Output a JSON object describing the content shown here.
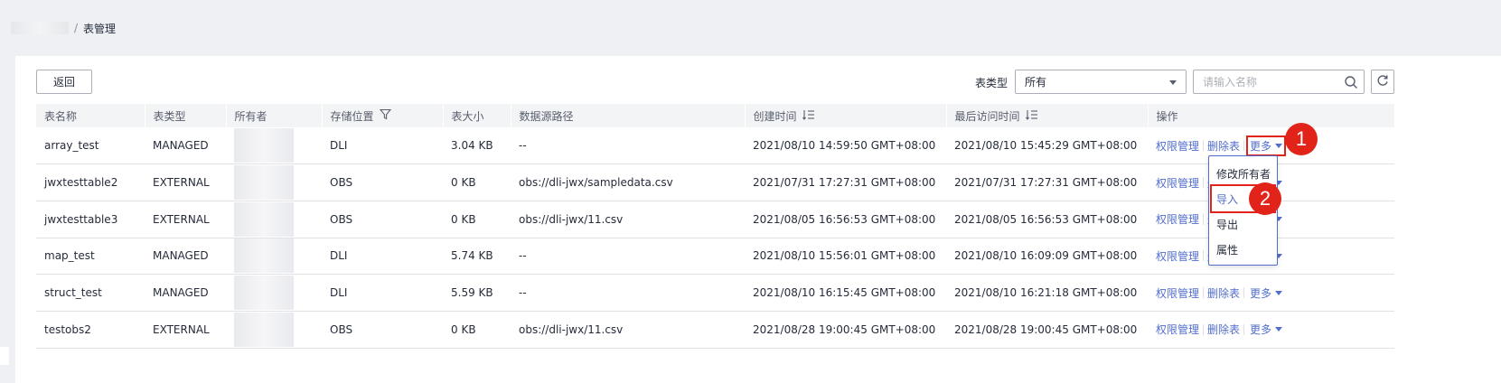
{
  "breadcrumb": {
    "separator": "/",
    "current": "表管理"
  },
  "toolbar": {
    "back_label": "返回",
    "filter_label": "表类型",
    "filter_value": "所有",
    "search_placeholder": "请输入名称"
  },
  "table": {
    "columns": [
      "表名称",
      "表类型",
      "所有者",
      "存储位置",
      "表大小",
      "数据源路径",
      "创建时间",
      "最后访问时间",
      "操作"
    ],
    "rows": [
      {
        "name": "array_test",
        "type": "MANAGED",
        "location": "DLI",
        "size": "3.04 KB",
        "path": "--",
        "created": "2021/08/10 14:59:50 GMT+08:00",
        "accessed": "2021/08/10 15:45:29 GMT+08:00"
      },
      {
        "name": "jwxtesttable2",
        "type": "EXTERNAL",
        "location": "OBS",
        "size": "0 KB",
        "path": "obs://dli-jwx/sampledata.csv",
        "created": "2021/07/31 17:27:31 GMT+08:00",
        "accessed": "2021/07/31 17:27:31 GMT+08:00"
      },
      {
        "name": "jwxtesttable3",
        "type": "EXTERNAL",
        "location": "OBS",
        "size": "0 KB",
        "path": "obs://dli-jwx/11.csv",
        "created": "2021/08/05 16:56:53 GMT+08:00",
        "accessed": "2021/08/05 16:56:53 GMT+08:00"
      },
      {
        "name": "map_test",
        "type": "MANAGED",
        "location": "DLI",
        "size": "5.74 KB",
        "path": "--",
        "created": "2021/08/10 15:56:01 GMT+08:00",
        "accessed": "2021/08/10 16:09:09 GMT+08:00"
      },
      {
        "name": "struct_test",
        "type": "MANAGED",
        "location": "DLI",
        "size": "5.59 KB",
        "path": "--",
        "created": "2021/08/10 16:15:45 GMT+08:00",
        "accessed": "2021/08/10 16:21:18 GMT+08:00"
      },
      {
        "name": "testobs2",
        "type": "EXTERNAL",
        "location": "OBS",
        "size": "0 KB",
        "path": "obs://dli-jwx/11.csv",
        "created": "2021/08/28 19:00:45 GMT+08:00",
        "accessed": "2021/08/28 19:00:45 GMT+08:00"
      }
    ],
    "op_permission": "权限管理",
    "op_delete": "删除表",
    "op_more": "更多"
  },
  "dropdown": {
    "items": [
      "修改所有者",
      "导入",
      "导出",
      "属性"
    ]
  },
  "callouts": [
    "1",
    "2"
  ],
  "icons": {
    "filter": "funnel-icon",
    "sort": "sort-icon",
    "search": "search-icon",
    "refresh": "refresh-icon"
  },
  "colors": {
    "link": "#526ecc",
    "highlight": "#e2231a",
    "header_bg": "#f3f4f6",
    "page_bg": "#eff0f4"
  }
}
